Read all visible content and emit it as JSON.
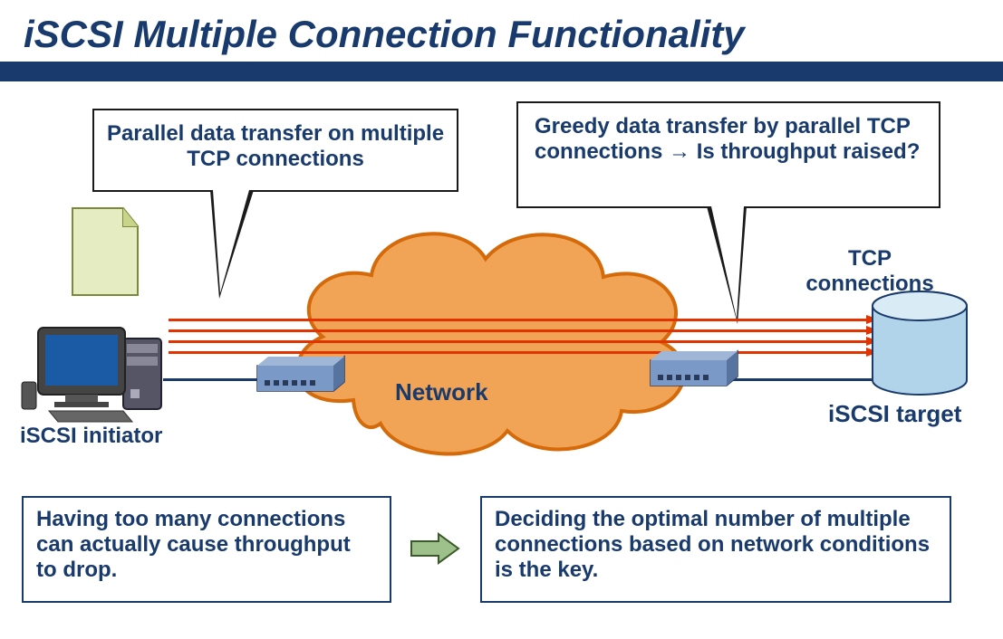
{
  "title": "iSCSI Multiple Connection Functionality",
  "callout_left": "Parallel data transfer on multiple TCP connections",
  "callout_right": "Greedy data transfer by parallel TCP connections → Is throughput raised?",
  "initiator_label": "iSCSI initiator",
  "network_label": "Network",
  "tcp_label": "TCP connections",
  "target_label": "iSCSI target",
  "bottom_left": "Having too many connections can actually cause throughput to drop.",
  "bottom_right": "Deciding the optimal number of multiple connections based on network conditions is the key.",
  "colors": {
    "title": "#193a6d",
    "cloud_fill": "#f1a455",
    "cloud_stroke": "#d46a09",
    "tcp_line": "#e23400",
    "note_fill": "#e5ecc1",
    "cylinder_fill": "#b1d4ea",
    "arrow_fill": "#9ec08a"
  },
  "tcp_connection_count": 4
}
